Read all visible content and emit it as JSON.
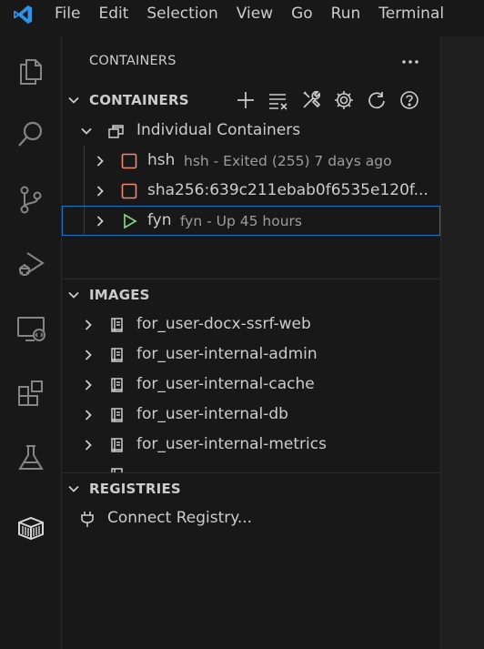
{
  "menu": [
    "File",
    "Edit",
    "Selection",
    "View",
    "Go",
    "Run",
    "Terminal"
  ],
  "activity_bar": [
    "files-icon",
    "search-icon",
    "source-control-icon",
    "run-debug-icon",
    "remote-explorer-icon",
    "extensions-icon",
    "testing-icon",
    "docker-icon"
  ],
  "sidebar": {
    "title": "CONTAINERS",
    "containers_section": {
      "title": "CONTAINERS",
      "group_label": "Individual Containers",
      "items": [
        {
          "label": "hsh",
          "description": "hsh - Exited (255) 7 days ago",
          "status": "stopped"
        },
        {
          "label": "sha256:639c211ebab0f6535e120f...",
          "description": "",
          "status": "stopped"
        },
        {
          "label": "fyn",
          "description": "fyn - Up 45 hours",
          "status": "running"
        }
      ]
    },
    "images_section": {
      "title": "IMAGES",
      "items": [
        "for_user-docx-ssrf-web",
        "for_user-internal-admin",
        "for_user-internal-cache",
        "for_user-internal-db",
        "for_user-internal-metrics"
      ]
    },
    "registries_section": {
      "title": "REGISTRIES",
      "connect_label": "Connect Registry..."
    }
  },
  "colors": {
    "background": "#181818",
    "accent_blue": "#1a75c2",
    "stopped_red": "#f48771",
    "running_green": "#89d185"
  }
}
